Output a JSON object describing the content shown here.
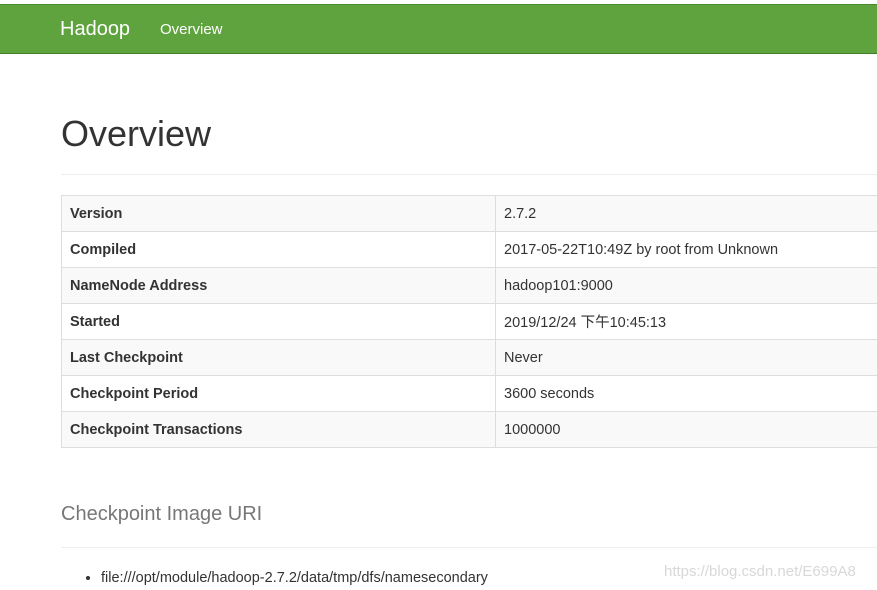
{
  "navbar": {
    "brand": "Hadoop",
    "links": [
      {
        "label": "Overview"
      }
    ],
    "color": "#5fa33e"
  },
  "page_title": "Overview",
  "info_table": [
    {
      "key": "Version",
      "value": "2.7.2"
    },
    {
      "key": "Compiled",
      "value": "2017-05-22T10:49Z by root from Unknown"
    },
    {
      "key": "NameNode Address",
      "value": "hadoop101:9000"
    },
    {
      "key": "Started",
      "value": "2019/12/24 下午10:45:13"
    },
    {
      "key": "Last Checkpoint",
      "value": "Never"
    },
    {
      "key": "Checkpoint Period",
      "value": "3600 seconds"
    },
    {
      "key": "Checkpoint Transactions",
      "value": "1000000"
    }
  ],
  "checkpoint_section": {
    "title": "Checkpoint Image URI",
    "uris": [
      "file:///opt/module/hadoop-2.7.2/data/tmp/dfs/namesecondary"
    ]
  },
  "watermark": "https://blog.csdn.net/E699A8"
}
